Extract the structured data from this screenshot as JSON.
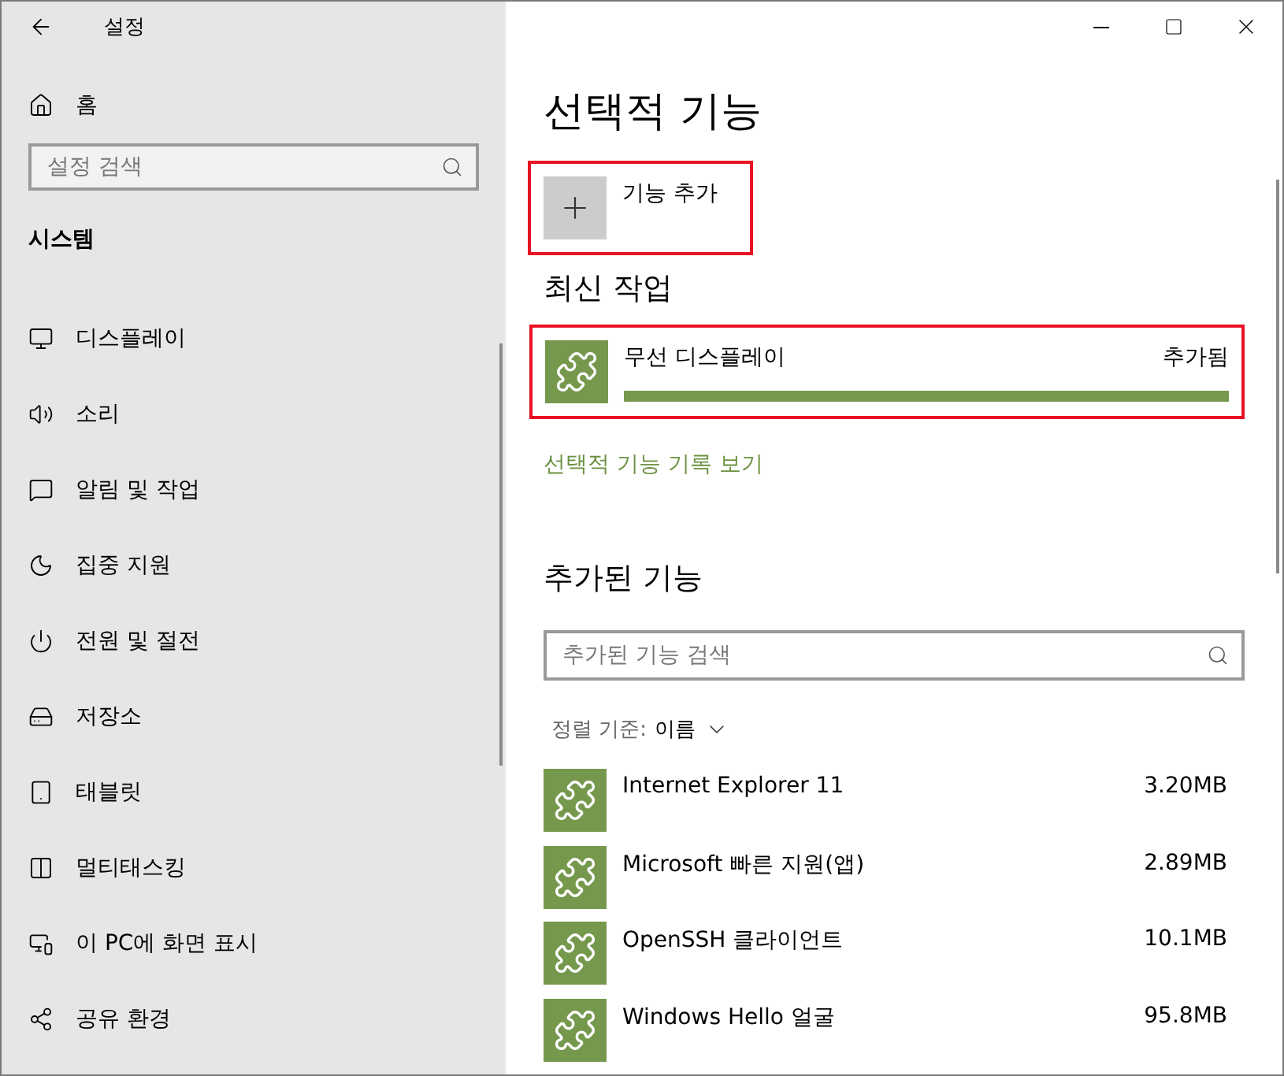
{
  "window": {
    "title": "설정"
  },
  "sidebar": {
    "home": "홈",
    "search": {
      "placeholder": "설정 검색"
    },
    "section": "시스템",
    "items": [
      {
        "label": "디스플레이"
      },
      {
        "label": "소리"
      },
      {
        "label": "알림 및 작업"
      },
      {
        "label": "집중 지원"
      },
      {
        "label": "전원 및 절전"
      },
      {
        "label": "저장소"
      },
      {
        "label": "태블릿"
      },
      {
        "label": "멀티태스킹"
      },
      {
        "label": "이 PC에 화면 표시"
      },
      {
        "label": "공유 환경"
      }
    ]
  },
  "page": {
    "title": "선택적 기능",
    "add_feature": {
      "label": "기능 추가",
      "highlighted": true
    },
    "recent": {
      "heading": "최신 작업",
      "items": [
        {
          "name": "무선 디스플레이",
          "status": "추가됨",
          "level": 1,
          "highlighted": true
        }
      ]
    },
    "history_link": "선택적 기능 기록 보기",
    "installed": {
      "heading": "추가된 기능",
      "search": {
        "placeholder": "추가된 기능 검색"
      },
      "sort": {
        "label": "정렬 기준:",
        "value": "이름"
      },
      "items": [
        {
          "name": "Internet Explorer 11",
          "size": "3.20MB"
        },
        {
          "name": "Microsoft 빠른 지원(앱)",
          "size": "2.89MB"
        },
        {
          "name": "OpenSSH 클라이언트",
          "size": "10.1MB"
        },
        {
          "name": "Windows Hello 얼굴",
          "size": "95.8MB"
        }
      ]
    }
  }
}
